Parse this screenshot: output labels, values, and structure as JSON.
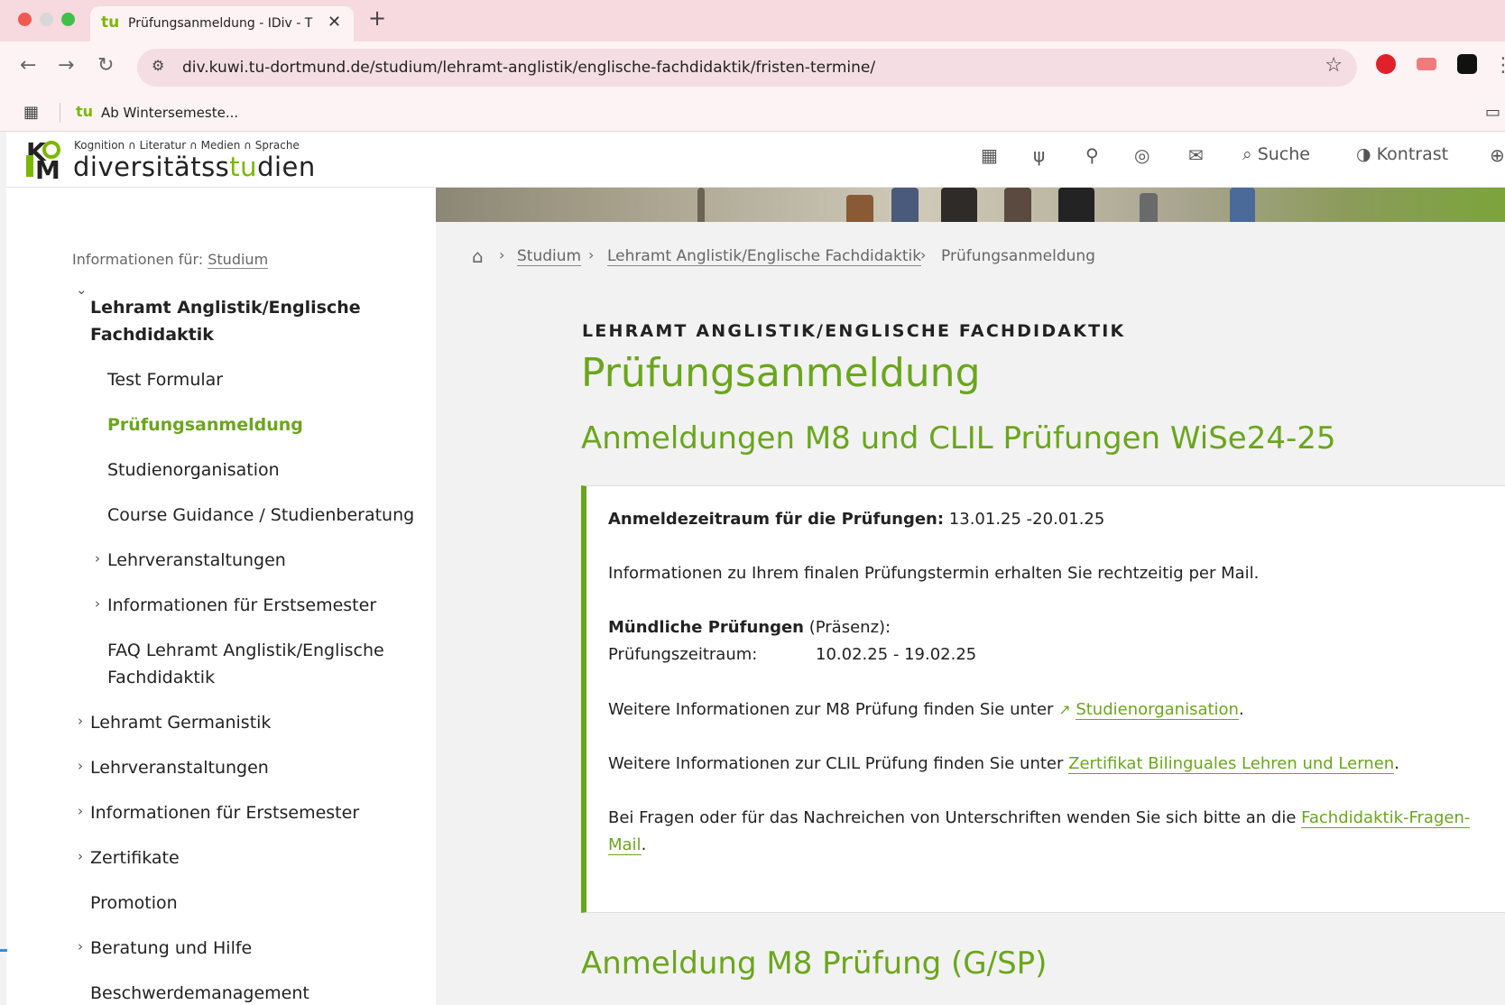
{
  "browser": {
    "tab_logo": "tu",
    "tab_title": "Prüfungsanmeldung - IDiv - T",
    "tab_close": "✕",
    "new_tab": "+",
    "url": "div.kuwi.tu-dortmund.de/studium/lehramt-anglistik/englische-fachdidaktik/fristen-termine/",
    "bookmark_logo": "tu",
    "bookmark_label": "Ab Wintersemeste..."
  },
  "header": {
    "tagline": "Kognition ∩ Literatur ∩ Medien ∩ Sprache",
    "site_name_a": "diversitätss",
    "site_name_b": "tu",
    "site_name_c": "dien",
    "search_label": "Suche",
    "contrast_label": "Kontrast"
  },
  "sidebar": {
    "info_prefix": "Informationen für:",
    "info_link": "Studium",
    "items": [
      {
        "label": "Lehramt Anglistik/Englische"
      },
      {
        "label": "Fachdidaktik"
      },
      {
        "label": "Test Formular"
      },
      {
        "label": "Prüfungsanmeldung"
      },
      {
        "label": "Studienorganisation"
      },
      {
        "label": "Course Guidance / Studienberatung"
      },
      {
        "label": "Lehrveranstaltungen"
      },
      {
        "label": "Informationen für Erstsemester"
      },
      {
        "label": "FAQ Lehramt Anglistik/Englische"
      },
      {
        "label": "Fachdidaktik"
      },
      {
        "label": "Lehramt Germanistik"
      },
      {
        "label": "Lehrveranstaltungen"
      },
      {
        "label": "Informationen für Erstsemester"
      },
      {
        "label": "Zertifikate"
      },
      {
        "label": "Promotion"
      },
      {
        "label": "Beratung und Hilfe"
      },
      {
        "label": "Beschwerdemanagement"
      }
    ]
  },
  "breadcrumb": {
    "items": [
      "Studium",
      "Lehramt Anglistik/Englische Fachdidaktik"
    ],
    "current": "Prüfungsanmeldung"
  },
  "content": {
    "kicker": "LEHRAMT ANGLISTIK/ENGLISCHE FACHDIDAKTIK",
    "title": "Prüfungsanmeldung",
    "subtitle": "Anmeldungen M8 und CLIL Prüfungen WiSe24-25",
    "period_label": "Anmeldezeitraum für die Prüfungen:",
    "period_value": "13.01.25 -20.01.25",
    "info_mail": "Informationen zu Ihrem finalen Prüfungstermin erhalten Sie rechtzeitig per Mail.",
    "oral_label": "Mündliche Prüfungen",
    "oral_suffix": "(Präsenz):",
    "exam_period_label": "Prüfungszeitraum:",
    "exam_period_value": "10.02.25 - 19.02.25",
    "m8_text": "Weitere Informationen zur M8 Prüfung finden Sie unter",
    "m8_link": "Studienorganisation",
    "clil_text": "Weitere Informationen zur CLIL Prüfung finden Sie unter",
    "clil_link": "Zertifikat Bilinguales Lehren und Lernen",
    "questions_text": "Bei Fragen oder für das Nachreichen von Unterschriften wenden Sie sich bitte an die",
    "questions_link_1": "Fachdidaktik-Fragen-",
    "questions_link_2": "Mail",
    "next_heading": "Anmeldung M8 Prüfung (G/SP)"
  },
  "colors": {
    "accent": "#6aa61c",
    "tabbar": "#f7d9e0"
  }
}
